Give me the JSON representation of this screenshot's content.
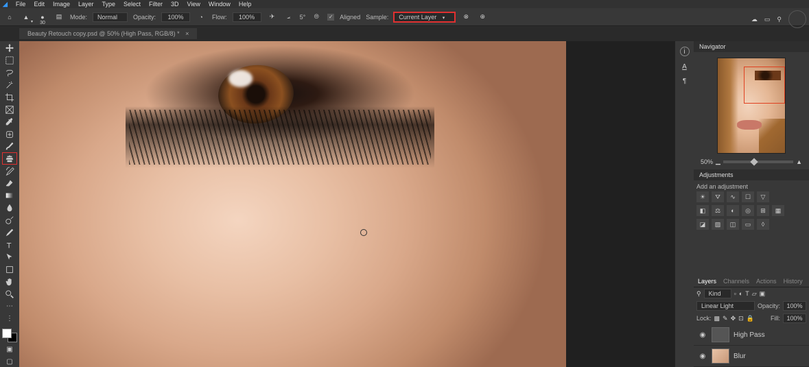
{
  "menu": [
    "File",
    "Edit",
    "Image",
    "Layer",
    "Type",
    "Select",
    "Filter",
    "3D",
    "View",
    "Window",
    "Help"
  ],
  "options": {
    "brush_size": "30",
    "mode_label": "Mode:",
    "mode_value": "Normal",
    "opacity_label": "Opacity:",
    "opacity_value": "100%",
    "flow_label": "Flow:",
    "flow_value": "100%",
    "angle_value": "5°",
    "aligned_label": "Aligned",
    "sample_label": "Sample:",
    "sample_value": "Current Layer"
  },
  "tab": {
    "title": "Beauty Retouch copy.psd @ 50% (High Pass, RGB/8) *"
  },
  "panels": {
    "navigator_title": "Navigator",
    "zoom": "50%",
    "adjustments_title": "Adjustments",
    "add_adj": "Add an adjustment",
    "layers_tabs": [
      "Layers",
      "Channels",
      "Actions",
      "History"
    ],
    "kind_label": "Kind",
    "blend_mode": "Linear Light",
    "opacity_label": "Opacity:",
    "opacity_value": "100%",
    "lock_label": "Lock:",
    "fill_label": "Fill:",
    "fill_value": "100%",
    "layer1": "High Pass",
    "layer2": "Blur"
  },
  "vstrip": {
    "a": "A",
    "pilcrow": "¶"
  }
}
